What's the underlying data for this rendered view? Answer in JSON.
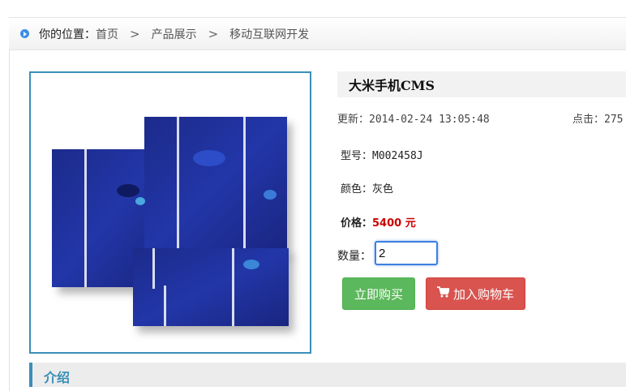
{
  "breadcrumb": {
    "label": "你的位置：",
    "items": [
      "首页",
      "产品展示",
      "移动互联网开发"
    ],
    "separator": ">"
  },
  "product": {
    "title": "大米手机CMS",
    "updated_label": "更新：",
    "updated_value": "2014-02-24 13:05:48",
    "clicks_label": "点击：",
    "clicks_value": "275",
    "model_label": "型号：",
    "model_value": "M002458J",
    "color_label": "颜色：",
    "color_value": "灰色",
    "price_label": "价格：",
    "price_value": "5400 元",
    "quantity_label": "数量：",
    "quantity_value": "2"
  },
  "actions": {
    "buy_label": "立即购买",
    "cart_label": "加入购物车"
  },
  "intro": {
    "heading": "介绍"
  },
  "icons": {
    "breadcrumb": "circle-arrow-icon",
    "cart": "shopping-cart-icon"
  },
  "colors": {
    "accent": "#3a8fb7",
    "buy_button": "#5cb85c",
    "cart_button": "#d9534f",
    "price": "#cc0000"
  }
}
